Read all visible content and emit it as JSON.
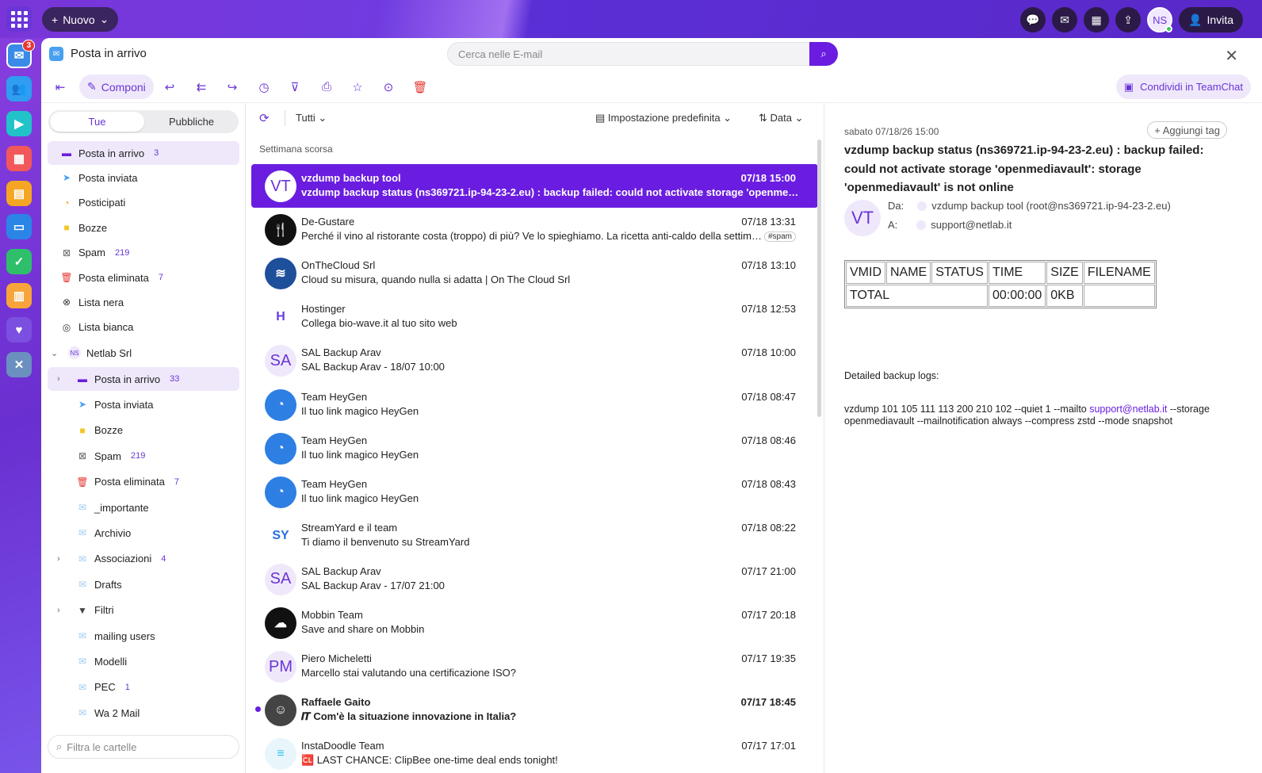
{
  "topbar": {
    "new_label": "Nuovo",
    "avatar_initials": "NS",
    "invite_label": "Invita",
    "mail_badge": "3"
  },
  "header": {
    "title": "Posta in arrivo",
    "search_placeholder": "Cerca nelle E-mail"
  },
  "toolbar": {
    "compose_label": "Componi",
    "share_label": "Condividi in TeamChat"
  },
  "folders": {
    "tab_mine": "Tue",
    "tab_public": "Pubbliche",
    "items": [
      {
        "label": "Posta in arrivo",
        "count": "3"
      },
      {
        "label": "Posta inviata",
        "count": ""
      },
      {
        "label": "Posticipati",
        "count": ""
      },
      {
        "label": "Bozze",
        "count": ""
      },
      {
        "label": "Spam",
        "count": "219"
      },
      {
        "label": "Posta eliminata",
        "count": "7"
      },
      {
        "label": "Lista nera",
        "count": ""
      },
      {
        "label": "Lista bianca",
        "count": ""
      }
    ],
    "account": {
      "initials": "NS",
      "label": "Netlab Srl"
    },
    "account_items": [
      {
        "label": "Posta in arrivo",
        "count": "33"
      },
      {
        "label": "Posta inviata",
        "count": ""
      },
      {
        "label": "Bozze",
        "count": ""
      },
      {
        "label": "Spam",
        "count": "219"
      },
      {
        "label": "Posta eliminata",
        "count": "7"
      },
      {
        "label": "_importante",
        "count": ""
      },
      {
        "label": "Archivio",
        "count": ""
      },
      {
        "label": "Associazioni",
        "count": "4"
      },
      {
        "label": "Drafts",
        "count": ""
      },
      {
        "label": "Filtri",
        "count": ""
      },
      {
        "label": "mailing users",
        "count": ""
      },
      {
        "label": "Modelli",
        "count": ""
      },
      {
        "label": "PEC",
        "count": "1"
      },
      {
        "label": "Wa 2 Mail",
        "count": ""
      }
    ],
    "filter_placeholder": "Filtra le cartelle"
  },
  "list": {
    "filter_label": "Tutti",
    "view_label": "Impostazione predefinita",
    "sort_label": "Data",
    "group_label": "Settimana scorsa",
    "messages": [
      {
        "avatar": "VT",
        "sender": "vzdump backup tool",
        "date": "07/18 15:00",
        "subject": "vzdump backup status (ns369721.ip-94-23-2.eu) : backup failed: could not activate storage 'openmediavault': storage 'openmediavault' is not online",
        "tag": ""
      },
      {
        "avatar": "",
        "sender": "De-Gustare",
        "date": "07/18 13:31",
        "subject": "Perché il vino al ristorante costa (troppo) di più? Ve lo spieghiamo. La ricetta anti-caldo della settimana",
        "tag": "#spam"
      },
      {
        "avatar": "",
        "sender": "OnTheCloud Srl",
        "date": "07/18 13:10",
        "subject": "Cloud su misura, quando nulla si adatta | On The Cloud Srl",
        "tag": ""
      },
      {
        "avatar": "",
        "sender": "Hostinger",
        "date": "07/18 12:53",
        "subject": "Collega bio-wave.it al tuo sito web",
        "tag": ""
      },
      {
        "avatar": "SA",
        "sender": "SAL Backup Arav",
        "date": "07/18 10:00",
        "subject": "SAL Backup Arav - 18/07 10:00",
        "tag": ""
      },
      {
        "avatar": "",
        "sender": "Team HeyGen",
        "date": "07/18 08:47",
        "subject": "Il tuo link magico HeyGen",
        "tag": ""
      },
      {
        "avatar": "",
        "sender": "Team HeyGen",
        "date": "07/18 08:46",
        "subject": "Il tuo link magico HeyGen",
        "tag": ""
      },
      {
        "avatar": "",
        "sender": "Team HeyGen",
        "date": "07/18 08:43",
        "subject": "Il tuo link magico HeyGen",
        "tag": ""
      },
      {
        "avatar": "",
        "sender": "StreamYard e il team",
        "date": "07/18 08:22",
        "subject": "Ti diamo il benvenuto su StreamYard",
        "tag": ""
      },
      {
        "avatar": "SA",
        "sender": "SAL Backup Arav",
        "date": "07/17 21:00",
        "subject": "SAL Backup Arav - 17/07 21:00",
        "tag": ""
      },
      {
        "avatar": "",
        "sender": "Mobbin Team",
        "date": "07/17 20:18",
        "subject": "Save and share on Mobbin",
        "tag": ""
      },
      {
        "avatar": "PM",
        "sender": "Piero Micheletti",
        "date": "07/17 19:35",
        "subject": "Marcello stai valutando una certificazione ISO?",
        "tag": ""
      },
      {
        "avatar": "",
        "sender": "Raffaele Gaito",
        "date": "07/17 18:45",
        "subject": "𝑰𝑻 Com'è la situazione innovazione in Italia?",
        "tag": ""
      },
      {
        "avatar": "",
        "sender": "InstaDoodle Team",
        "date": "07/17 17:01",
        "subject": "🆑 LAST CHANCE: ClipBee one-time deal ends tonight!",
        "tag": ""
      }
    ]
  },
  "reader": {
    "date": "sabato 07/18/26 15:00",
    "add_tag": "+ Aggiungi tag",
    "subject": "vzdump backup status (ns369721.ip-94-23-2.eu) : backup failed: could not activate storage 'openmediavault': storage 'openmediavault' is not online",
    "avatar": "VT",
    "from_label": "Da:",
    "from_value": "vzdump backup tool (root@ns369721.ip-94-23-2.eu)",
    "to_label": "A:",
    "to_value": "support@netlab.it",
    "table_headers": [
      "VMID",
      "NAME",
      "STATUS",
      "TIME",
      "SIZE",
      "FILENAME"
    ],
    "table_total": "TOTAL",
    "table_time": "00:00:00",
    "table_size": "0KB",
    "logs_label": "Detailed backup logs:",
    "cmd_prefix": "vzdump 101 105 111 113 200 210 102 --quiet 1 --mailto ",
    "cmd_link": "support@netlab.it",
    "cmd_suffix": " --storage openmediavault --mailnotification always --compress zstd --mode snapshot"
  },
  "colors": {
    "accent": "#6a1de0",
    "selected_bg": "#efe8fb"
  }
}
